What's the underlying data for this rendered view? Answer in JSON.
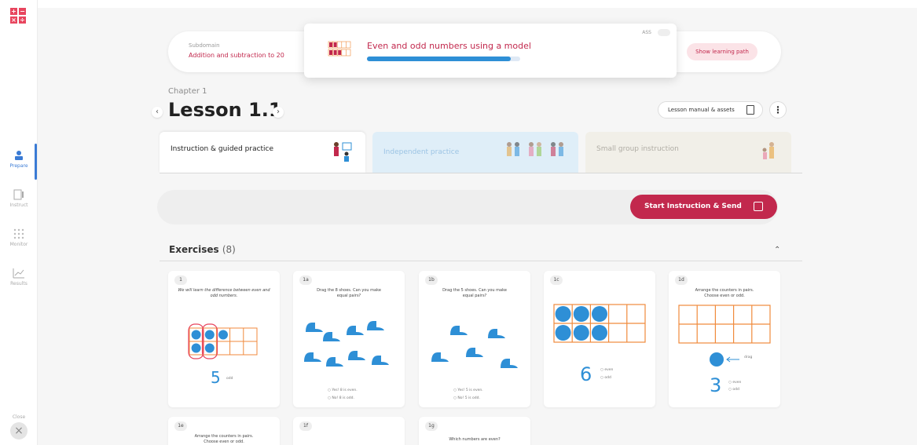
{
  "rail": {
    "items": [
      {
        "label": "Prepare",
        "icon": "prepare-icon"
      },
      {
        "label": "Instruct",
        "icon": "instruct-icon"
      },
      {
        "label": "Monitor",
        "icon": "monitor-icon"
      },
      {
        "label": "Results",
        "icon": "results-icon"
      }
    ],
    "close_label": "Close",
    "active_color": "#3a7bd5"
  },
  "subdomain": {
    "label": "Subdomain",
    "value": "Addition and subtraction to 20",
    "path_button": "Show learning path"
  },
  "lesson_card": {
    "title": "Even and odd numbers using a model",
    "progress": 0.94,
    "code": "ASS"
  },
  "chapter": "Chapter 1",
  "lesson_num": "Lesson 1.1",
  "manual_button": "Lesson manual & assets",
  "tabs": [
    {
      "label": "Instruction & guided practice"
    },
    {
      "label": "Independent practice"
    },
    {
      "label": "Small group instruction"
    }
  ],
  "send_button": "Start Instruction & Send",
  "exercises": {
    "title": "Exercises",
    "count": "(8)",
    "cards": [
      {
        "badge": "1",
        "prompt": "We will learn the difference between even and odd numbers.",
        "number": "5",
        "option": "odd"
      },
      {
        "badge": "1a",
        "prompt": "Drag the 8 shoes. Can you make equal pairs?",
        "options": [
          "Yes! 8 is even.",
          "No! 8 is odd."
        ]
      },
      {
        "badge": "1b",
        "prompt": "Drag the 5 shoes. Can you make equal pairs?",
        "options": [
          "Yes! 5 is even.",
          "No! 5 is odd."
        ]
      },
      {
        "badge": "1c",
        "number": "6",
        "options": [
          "even",
          "odd"
        ]
      },
      {
        "badge": "1d",
        "prompt": "Arrange the counters in pairs. Choose even or odd.",
        "drag_label": "drag",
        "number": "3",
        "options": [
          "even",
          "odd"
        ]
      },
      {
        "badge": "1e",
        "prompt": "Arrange the counters in pairs. Choose even or odd."
      },
      {
        "badge": "1f"
      },
      {
        "badge": "1g",
        "prompt": "Which numbers are even?"
      }
    ]
  },
  "colors": {
    "brand": "#c2284d",
    "accent": "#2e8fd6",
    "grid": "#f08a3c"
  }
}
